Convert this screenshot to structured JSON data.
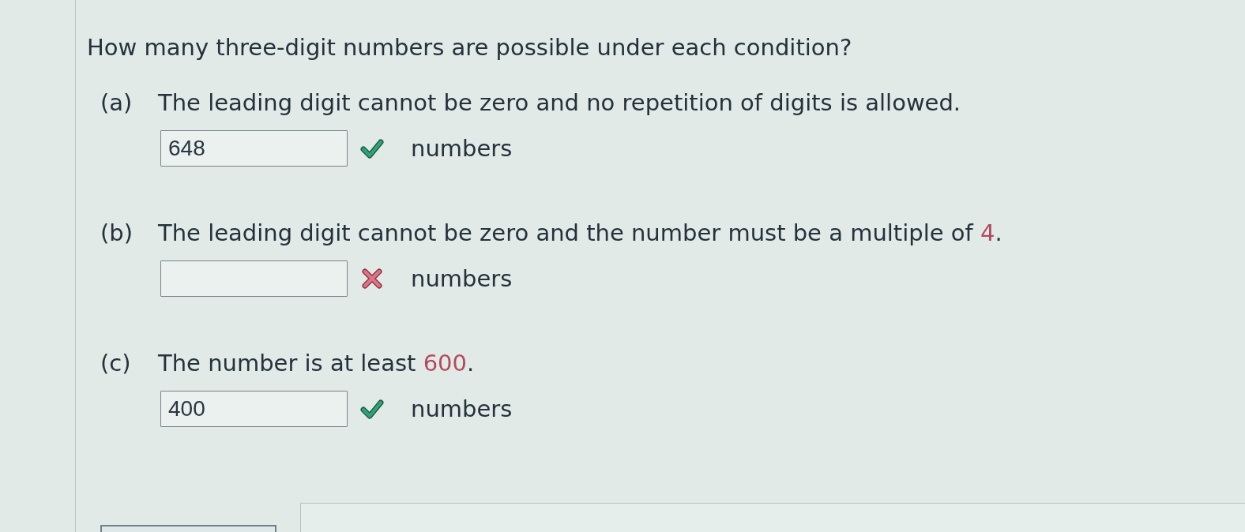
{
  "question": {
    "text": "How many three-digit numbers are possible under each condition?"
  },
  "parts": [
    {
      "label": "(a)",
      "prompt": [
        {
          "kind": "plain",
          "text": "The leading digit cannot be zero and no repetition of digits is allowed."
        }
      ],
      "answer": {
        "value": "648",
        "correct": true
      },
      "unit": "numbers"
    },
    {
      "label": "(b)",
      "prompt": [
        {
          "kind": "plain",
          "text": "The leading digit cannot be zero and the number must be a multiple of "
        },
        {
          "kind": "highlight",
          "text": "4"
        },
        {
          "kind": "plain",
          "text": "."
        }
      ],
      "answer": {
        "correct": false
      },
      "unit": "numbers"
    },
    {
      "label": "(c)",
      "prompt": [
        {
          "kind": "plain",
          "text": "The number is at least "
        },
        {
          "kind": "highlight",
          "text": "600"
        },
        {
          "kind": "plain",
          "text": "."
        }
      ],
      "answer": {
        "value": "400",
        "correct": true
      },
      "unit": "numbers"
    }
  ]
}
